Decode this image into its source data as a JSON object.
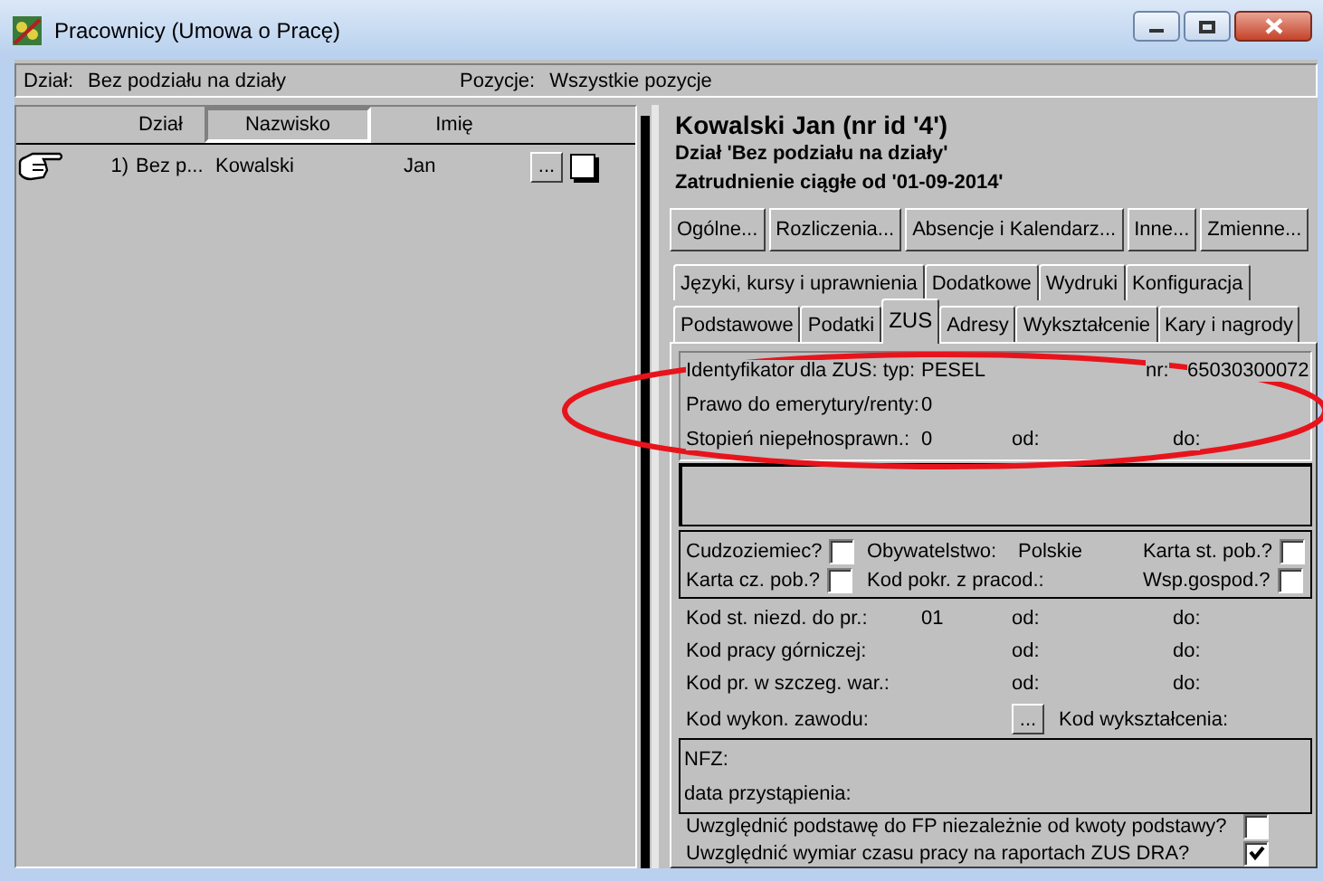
{
  "window": {
    "title": "Pracownicy (Umowa o Pracę)"
  },
  "filter_bar": {
    "dzial_label": "Dział:",
    "dzial_value": "Bez podziału na działy",
    "pozycje_label": "Pozycje:",
    "pozycje_value": "Wszystkie pozycje"
  },
  "list": {
    "columns": [
      {
        "label": "Dział",
        "selected": false
      },
      {
        "label": "Nazwisko",
        "selected": true
      },
      {
        "label": "Imię",
        "selected": false
      }
    ],
    "rows": [
      {
        "number": "1)",
        "dzial": "Bez p...",
        "nazwisko": "Kowalski",
        "imie": "Jan",
        "button": "...",
        "checked": false,
        "selected": true
      }
    ]
  },
  "employee": {
    "name": "Kowalski Jan (nr id '4')",
    "dzial": "Dział 'Bez podziału na działy'",
    "zatrudnienie": "Zatrudnienie ciągłe od '01-09-2014'"
  },
  "buttons": [
    "Ogólne...",
    "Rozliczenia...",
    "Absencje i Kalendarz...",
    "Inne...",
    "Zmienne..."
  ],
  "tab_rows": [
    [
      {
        "label": "Języki, kursy i uprawnienia",
        "selected": false
      },
      {
        "label": "Dodatkowe",
        "selected": false
      },
      {
        "label": "Wydruki",
        "selected": false
      },
      {
        "label": "Konfiguracja",
        "selected": false
      }
    ],
    [
      {
        "label": "Podstawowe",
        "selected": false
      },
      {
        "label": "Podatki",
        "selected": false
      },
      {
        "label": "ZUS",
        "selected": true
      },
      {
        "label": "Adresy",
        "selected": false
      },
      {
        "label": "Wykształcenie",
        "selected": false
      },
      {
        "label": "Kary i nagrody",
        "selected": false
      }
    ]
  ],
  "zus": {
    "id_rows": [
      {
        "kind": "id",
        "label": "Identyfikator dla ZUS: typ:",
        "value": "PESEL",
        "nr_label": "nr:",
        "nr": "65030300072"
      },
      {
        "kind": "field",
        "label": "Prawo do emerytury/renty:",
        "value": "0"
      },
      {
        "kind": "field",
        "label": "Stopień niepełnosprawn.:",
        "value": "0",
        "from": "od:",
        "to": "do:"
      }
    ],
    "flags": [
      {
        "kind": "check",
        "label": "Cudzoziemiec?",
        "checked": false
      },
      {
        "kind": "value",
        "label": "Obywatelstwo:",
        "value": "Polskie"
      },
      {
        "kind": "check",
        "label": "Karta st. pob.?",
        "checked": false
      },
      {
        "kind": "check",
        "label": "Karta cz. pob.?",
        "checked": false
      },
      {
        "kind": "value",
        "label": "Kod pokr. z pracod.:"
      },
      {
        "kind": "check",
        "label": "Wsp.gospod.?",
        "checked": false
      }
    ],
    "codes": [
      {
        "kind": "field",
        "label": "Kod st. niezd. do pr.:",
        "value": "01",
        "from": "od:",
        "to": "do:"
      },
      {
        "kind": "field",
        "label": "Kod pracy górniczej:",
        "from": "od:",
        "to": "do:"
      },
      {
        "kind": "field",
        "label": "Kod pr. w szczeg. war.:",
        "from": "od:",
        "to": "do:"
      },
      {
        "kind": "button",
        "label": "Kod wykon. zawodu:",
        "button": "...",
        "extra": "Kod wykształcenia:"
      }
    ],
    "nfz": [
      "NFZ:",
      "data przystąpienia:"
    ],
    "options": [
      {
        "label": "Uwzględnić podstawę do FP niezależnie od kwoty podstawy?",
        "checked": false
      },
      {
        "label": "Uwzględnić wymiar czasu pracy na raportach ZUS DRA?",
        "checked": true
      }
    ]
  },
  "annotations": [
    {
      "kind": "ellipse"
    }
  ]
}
